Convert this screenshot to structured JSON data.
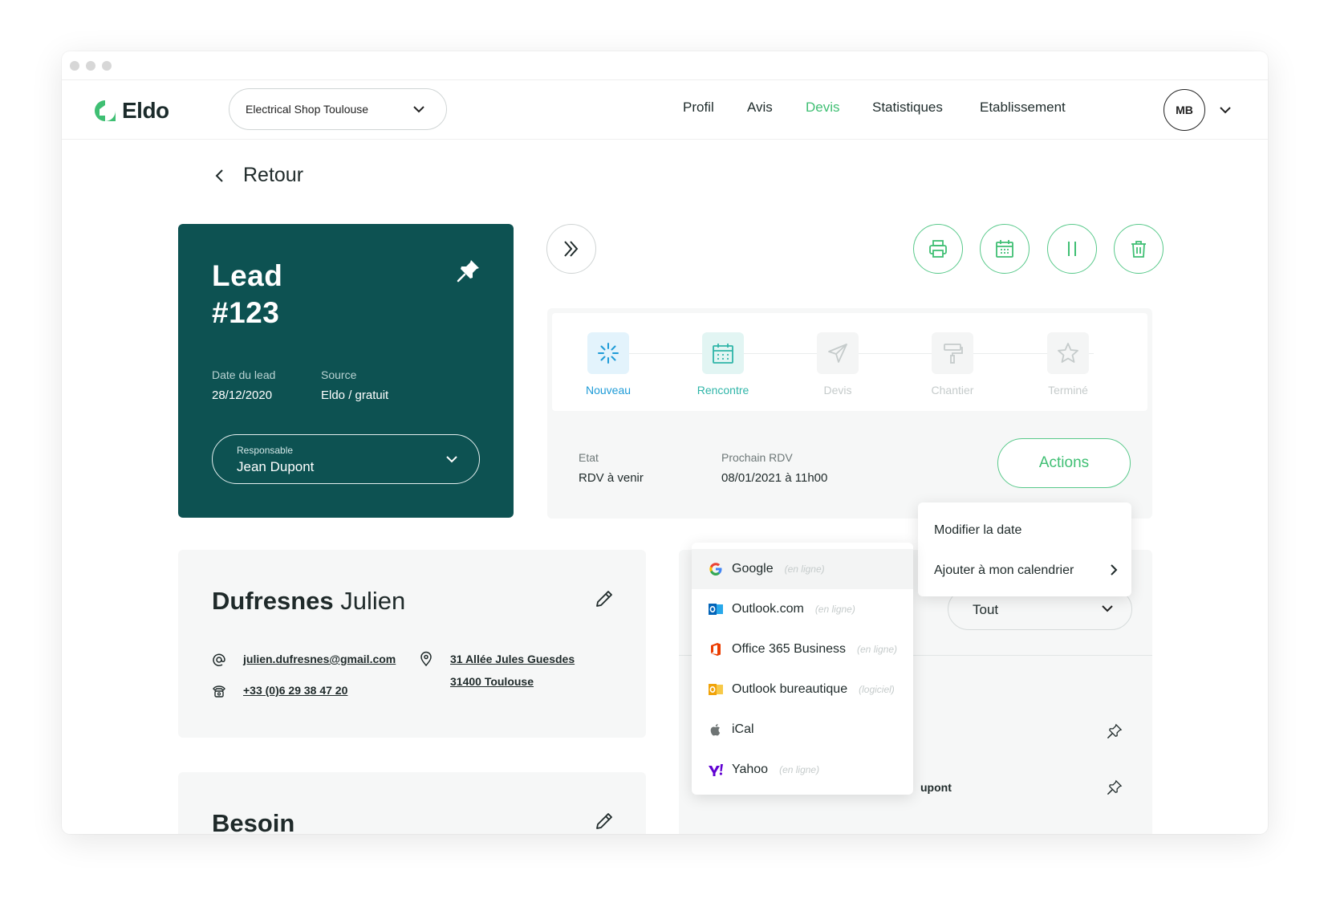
{
  "app": {
    "logo_text": "Eldo"
  },
  "nav": {
    "shop_select": "Electrical Shop Toulouse",
    "items": [
      {
        "label": "Profil"
      },
      {
        "label": "Avis"
      },
      {
        "label": "Devis"
      },
      {
        "label": "Statistiques"
      },
      {
        "label": "Etablissement"
      }
    ],
    "active": "Devis",
    "avatar_initials": "MB"
  },
  "back": {
    "label": "Retour"
  },
  "lead": {
    "title_line1": "Lead",
    "title_line2": "#123",
    "date_label": "Date du lead",
    "date_value": "28/12/2020",
    "source_label": "Source",
    "source_value": "Eldo / gratuit",
    "responsable_label": "Responsable",
    "responsable_value": "Jean Dupont"
  },
  "steps": [
    {
      "label": "Nouveau",
      "state": "done",
      "icon": "spinner-icon"
    },
    {
      "label": "Rencontre",
      "state": "current",
      "icon": "calendar-icon"
    },
    {
      "label": "Devis",
      "state": "todo",
      "icon": "paper-plane-icon"
    },
    {
      "label": "Chantier",
      "state": "todo",
      "icon": "paint-roller-icon"
    },
    {
      "label": "Terminé",
      "state": "todo",
      "icon": "star-icon"
    }
  ],
  "status": {
    "etat_label": "Etat",
    "etat_value": "RDV à venir",
    "rdv_label": "Prochain RDV",
    "rdv_value": "08/01/2021 à 11h00",
    "actions_label": "Actions"
  },
  "actions_menu": {
    "items": [
      {
        "label": "Modifier la date"
      },
      {
        "label": "Ajouter à mon calendrier"
      }
    ]
  },
  "calendar_menu": {
    "items": [
      {
        "name": "Google",
        "note": "(en ligne)",
        "icon": "google-icon"
      },
      {
        "name": "Outlook.com",
        "note": "(en ligne)",
        "icon": "outlook-icon"
      },
      {
        "name": "Office 365 Business",
        "note": "(en ligne)",
        "icon": "office-icon"
      },
      {
        "name": "Outlook bureautique",
        "note": "(logiciel)",
        "icon": "outlook-desktop-icon"
      },
      {
        "name": "iCal",
        "note": "",
        "icon": "apple-icon"
      },
      {
        "name": "Yahoo",
        "note": "(en ligne)",
        "icon": "yahoo-icon"
      }
    ]
  },
  "contact": {
    "last_name": "Dufresnes",
    "first_name": "Julien",
    "email": "julien.dufresnes@gmail.com",
    "phone": "+33 (0)6 29 38 47 20",
    "address_line1": "31 Allée Jules Guesdes",
    "address_line2": "31400 Toulouse"
  },
  "besoin": {
    "title": "Besoin"
  },
  "history": {
    "filter_value": "Tout",
    "partial_text": "upont"
  },
  "colors": {
    "brand_green": "#3fbf73",
    "lead_card": "#0d5252",
    "step_blue": "#1e9bd7",
    "step_teal": "#2fb5a8"
  }
}
